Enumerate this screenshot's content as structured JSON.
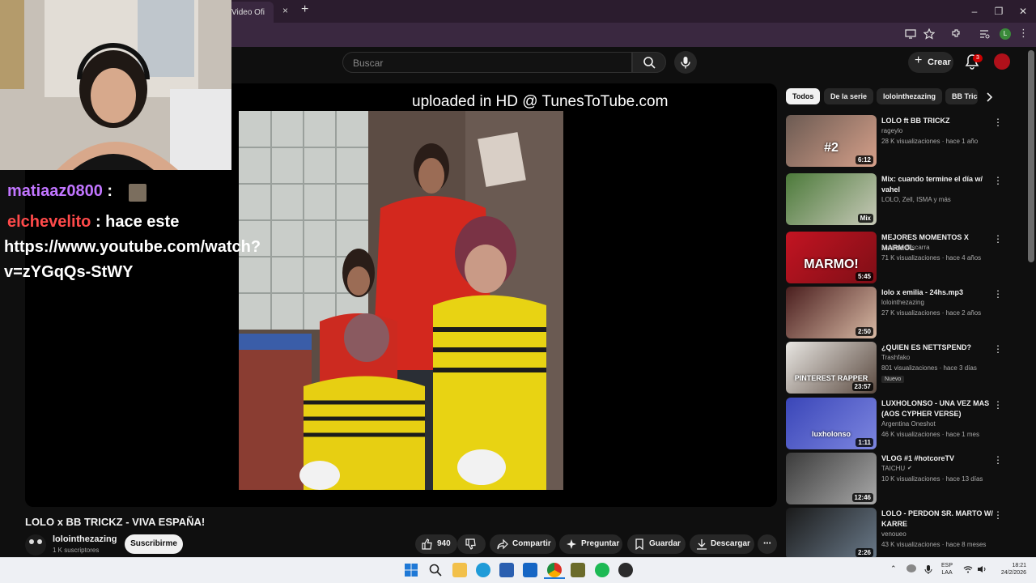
{
  "browser": {
    "tab_title": "Video Ofi",
    "tab_close_glyph": "×",
    "new_tab_glyph": "+",
    "window_controls": {
      "minimize": "–",
      "restore": "❐",
      "close": "✕"
    }
  },
  "header": {
    "search_placeholder": "Buscar",
    "create_label": "Crear",
    "notification_count": "3"
  },
  "chat": {
    "lines": [
      {
        "user": "matiaaz0800",
        "separator": " :"
      },
      {
        "user": "elchevelito",
        "message": " : hace este"
      },
      {
        "message": "https://www.youtube.com/watch?"
      },
      {
        "message": "v=zYGqQs-StWY"
      }
    ]
  },
  "player": {
    "watermark": "uploaded in HD @ TunesToTube.com"
  },
  "video": {
    "title": "LOLO x BB TRICKZ - VIVA ESPAÑA!",
    "channel": "lolointhezazing",
    "subscribers": "1 K suscriptores",
    "subscribe_label": "Suscribirme",
    "likes": "940",
    "share_label": "Compartir",
    "ask_label": "Preguntar",
    "save_label": "Guardar",
    "download_label": "Descargar",
    "more_glyph": "⋯"
  },
  "sidebar": {
    "chips": [
      "Todos",
      "De la serie",
      "lolointhezazing",
      "BB Trickz"
    ],
    "recommendations": [
      {
        "title": "LOLO ft BB TRICKZ",
        "channel": "rageylo",
        "meta": "28 K visualizaciones · hace 1 año",
        "duration": "6:12",
        "thumb_text": "#2",
        "colors": [
          "#6b5a52",
          "#d6a08a"
        ]
      },
      {
        "title": "Mix: cuando termine el día w/ vahel",
        "channel": "LOLO, Zell, ISMA y más",
        "meta": "",
        "duration": "Mix",
        "thumb_text": "",
        "colors": [
          "#4c7a3a",
          "#c7c9b8"
        ]
      },
      {
        "title": "MEJORES MOMENTOS X MARMOL",
        "channel": "Luciano Biscarra",
        "meta": "71 K visualizaciones · hace 4 años",
        "duration": "5:45",
        "thumb_text": "MARMO!",
        "colors": [
          "#c31422",
          "#7e0e16"
        ]
      },
      {
        "title": "lolo x emilia - 24hs.mp3",
        "channel": "lolointhezazing",
        "meta": "27 K visualizaciones · hace 2 años",
        "duration": "2:50",
        "thumb_text": "",
        "colors": [
          "#4a1e1e",
          "#d8b9a4"
        ]
      },
      {
        "title": "¿QUIEN ES NETTSPEND?",
        "channel": "Trashfako",
        "meta": "801 visualizaciones · hace 3 días",
        "badge": "Nuevo",
        "duration": "23:57",
        "thumb_text": "PINTEREST RAPPER",
        "colors": [
          "#e8e6e2",
          "#5b4a40"
        ]
      },
      {
        "title": "LUXHOLONSO - UNA VEZ MAS (AOS CYPHER VERSE)",
        "channel": "Argentina Oneshot",
        "meta": "46 K visualizaciones · hace 1 mes",
        "duration": "1:11",
        "thumb_text": "luxholonso",
        "colors": [
          "#3a46b8",
          "#7d86e0"
        ]
      },
      {
        "title": "VLOG #1 #hotcoreTV",
        "channel": "TAICHU",
        "verified_glyph": "✔",
        "meta": "10 K visualizaciones · hace 13 días",
        "duration": "12:46",
        "thumb_text": "",
        "colors": [
          "#3b3b3b",
          "#a9a9a9"
        ]
      },
      {
        "title": "LOLO - PERDON SR. MARTO W/ KARRE",
        "channel": "venoueo",
        "meta": "43 K visualizaciones · hace 8 meses",
        "duration": "2:26",
        "thumb_text": "",
        "colors": [
          "#1a1a1a",
          "#6a7a8a"
        ]
      }
    ]
  },
  "taskbar": {
    "lang_top": "ESP",
    "lang_bottom": "LAA",
    "time": "18:21",
    "date": "24/2/2026"
  }
}
